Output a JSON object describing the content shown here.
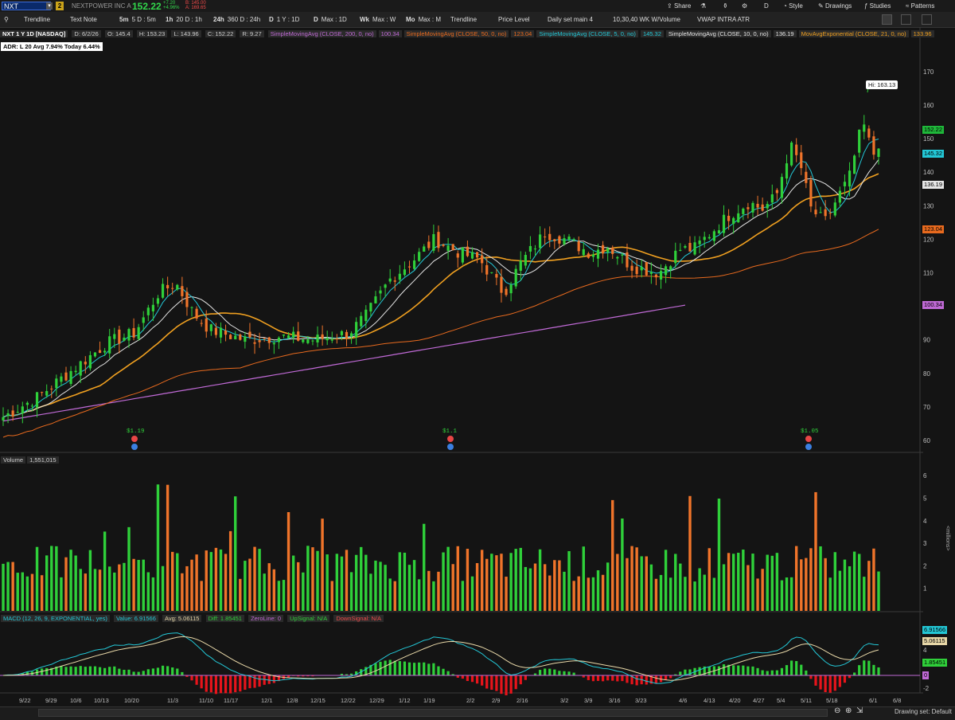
{
  "header": {
    "symbol": "NXT",
    "link_badge": "2",
    "company": "NEXTPOWER INC A",
    "last": "152.22",
    "change": "+7.20",
    "change_pct": "+4.96%",
    "bid": "B: 145.00",
    "ask": "A: 169.65",
    "share_label": "Share",
    "style_label": "Style",
    "drawings_label": "Drawings",
    "studies_label": "Studies",
    "patterns_label": "Patterns",
    "d_label": "D"
  },
  "tools": [
    {
      "key": "",
      "label": "Trendline"
    },
    {
      "key": "",
      "label": "Text Note"
    },
    {
      "key": "5m",
      "label": "5 D : 5m"
    },
    {
      "key": "1h",
      "label": "20 D : 1h"
    },
    {
      "key": "24h",
      "label": "360 D : 24h"
    },
    {
      "key": "D",
      "label": "1 Y : 1D"
    },
    {
      "key": "D",
      "label": "Max : 1D"
    },
    {
      "key": "Wk",
      "label": "Max : W"
    },
    {
      "key": "Mo",
      "label": "Max : M"
    },
    {
      "key": "",
      "label": "Trendline"
    },
    {
      "key": "",
      "label": "Price Level"
    },
    {
      "key": "",
      "label": "Daily set main 4"
    },
    {
      "key": "",
      "label": "10,30,40 WK W/Volume"
    },
    {
      "key": "",
      "label": "VWAP INTRA ATR"
    }
  ],
  "info": {
    "title": "NXT 1 Y 1D [NASDAQ]",
    "date": "D: 6/2/26",
    "open": "O: 145.4",
    "high": "H: 153.23",
    "low": "L: 143.96",
    "close": "C: 152.22",
    "range": "R: 9.27",
    "studies": [
      {
        "name": "SimpleMovingAvg (CLOSE, 200, 0, no)",
        "value": "100.34",
        "color": "#c06ad6"
      },
      {
        "name": "SimpleMovingAvg (CLOSE, 50, 0, no)",
        "value": "123.04",
        "color": "#e86a1e"
      },
      {
        "name": "SimpleMovingAvg (CLOSE, 5, 0, no)",
        "value": "145.32",
        "color": "#23c7d6"
      },
      {
        "name": "SimpleMovingAvg (CLOSE, 10, 0, no)",
        "value": "136.19",
        "color": "#e6e6e6"
      },
      {
        "name": "MovAvgExponential (CLOSE, 21, 0, no)",
        "value": "133.96",
        "color": "#f0a020"
      }
    ],
    "adr": "ADR: L 20  Avg 7.94%  Today 6.44%",
    "hi_label": "Hi: 163.13"
  },
  "volume": {
    "label": "Volume",
    "value": "1,551,015",
    "unit": "<millions>"
  },
  "macd": {
    "label": "MACD (12, 26, 9, EXPONENTIAL, yes)",
    "value": "Value: 6.91566",
    "avg": "Avg: 5.06115",
    "diff": "Diff: 1.85451",
    "zero": "ZeroLine: 0",
    "up": "UpSignal: N/A",
    "down": "DownSignal: N/A",
    "tags": [
      "6.91566",
      "5.06115",
      "1.85451",
      "0"
    ]
  },
  "price_axis": {
    "ticks": [
      "170",
      "160",
      "150",
      "140",
      "130",
      "120",
      "110",
      "100",
      "90",
      "80",
      "70",
      "60"
    ]
  },
  "volume_axis": {
    "ticks": [
      "6",
      "5",
      "4",
      "3",
      "2",
      "1"
    ]
  },
  "macd_axis": {
    "ticks": [
      "4",
      "2",
      "-2"
    ]
  },
  "axis_tags": [
    {
      "text": "152.22",
      "bg": "#1fb83a",
      "fg": "#000"
    },
    {
      "text": "145.32",
      "bg": "#23c7d6",
      "fg": "#000"
    },
    {
      "text": "136.19",
      "bg": "#e6e6e6",
      "fg": "#000"
    },
    {
      "text": "123.04",
      "bg": "#e86a1e",
      "fg": "#000"
    },
    {
      "text": "100.34",
      "bg": "#c06ad6",
      "fg": "#000"
    }
  ],
  "dividends": [
    {
      "text": "$1.19"
    },
    {
      "text": "$1.1"
    },
    {
      "text": "$1.05"
    }
  ],
  "dates": [
    "9/22",
    "9/29",
    "10/6",
    "10/13",
    "10/20",
    "11/3",
    "11/10",
    "11/17",
    "12/1",
    "12/8",
    "12/15",
    "12/22",
    "12/29",
    "1/12",
    "1/19",
    "2/2",
    "2/9",
    "2/16",
    "3/2",
    "3/9",
    "3/16",
    "3/23",
    "4/6",
    "4/13",
    "4/20",
    "4/27",
    "5/4",
    "5/11",
    "5/18",
    "6/1",
    "6/8"
  ],
  "status": {
    "drawing_set": "Drawing set: Default"
  },
  "colors": {
    "up": "#2fd03a",
    "down": "#f0742a",
    "bg": "#141414"
  }
}
